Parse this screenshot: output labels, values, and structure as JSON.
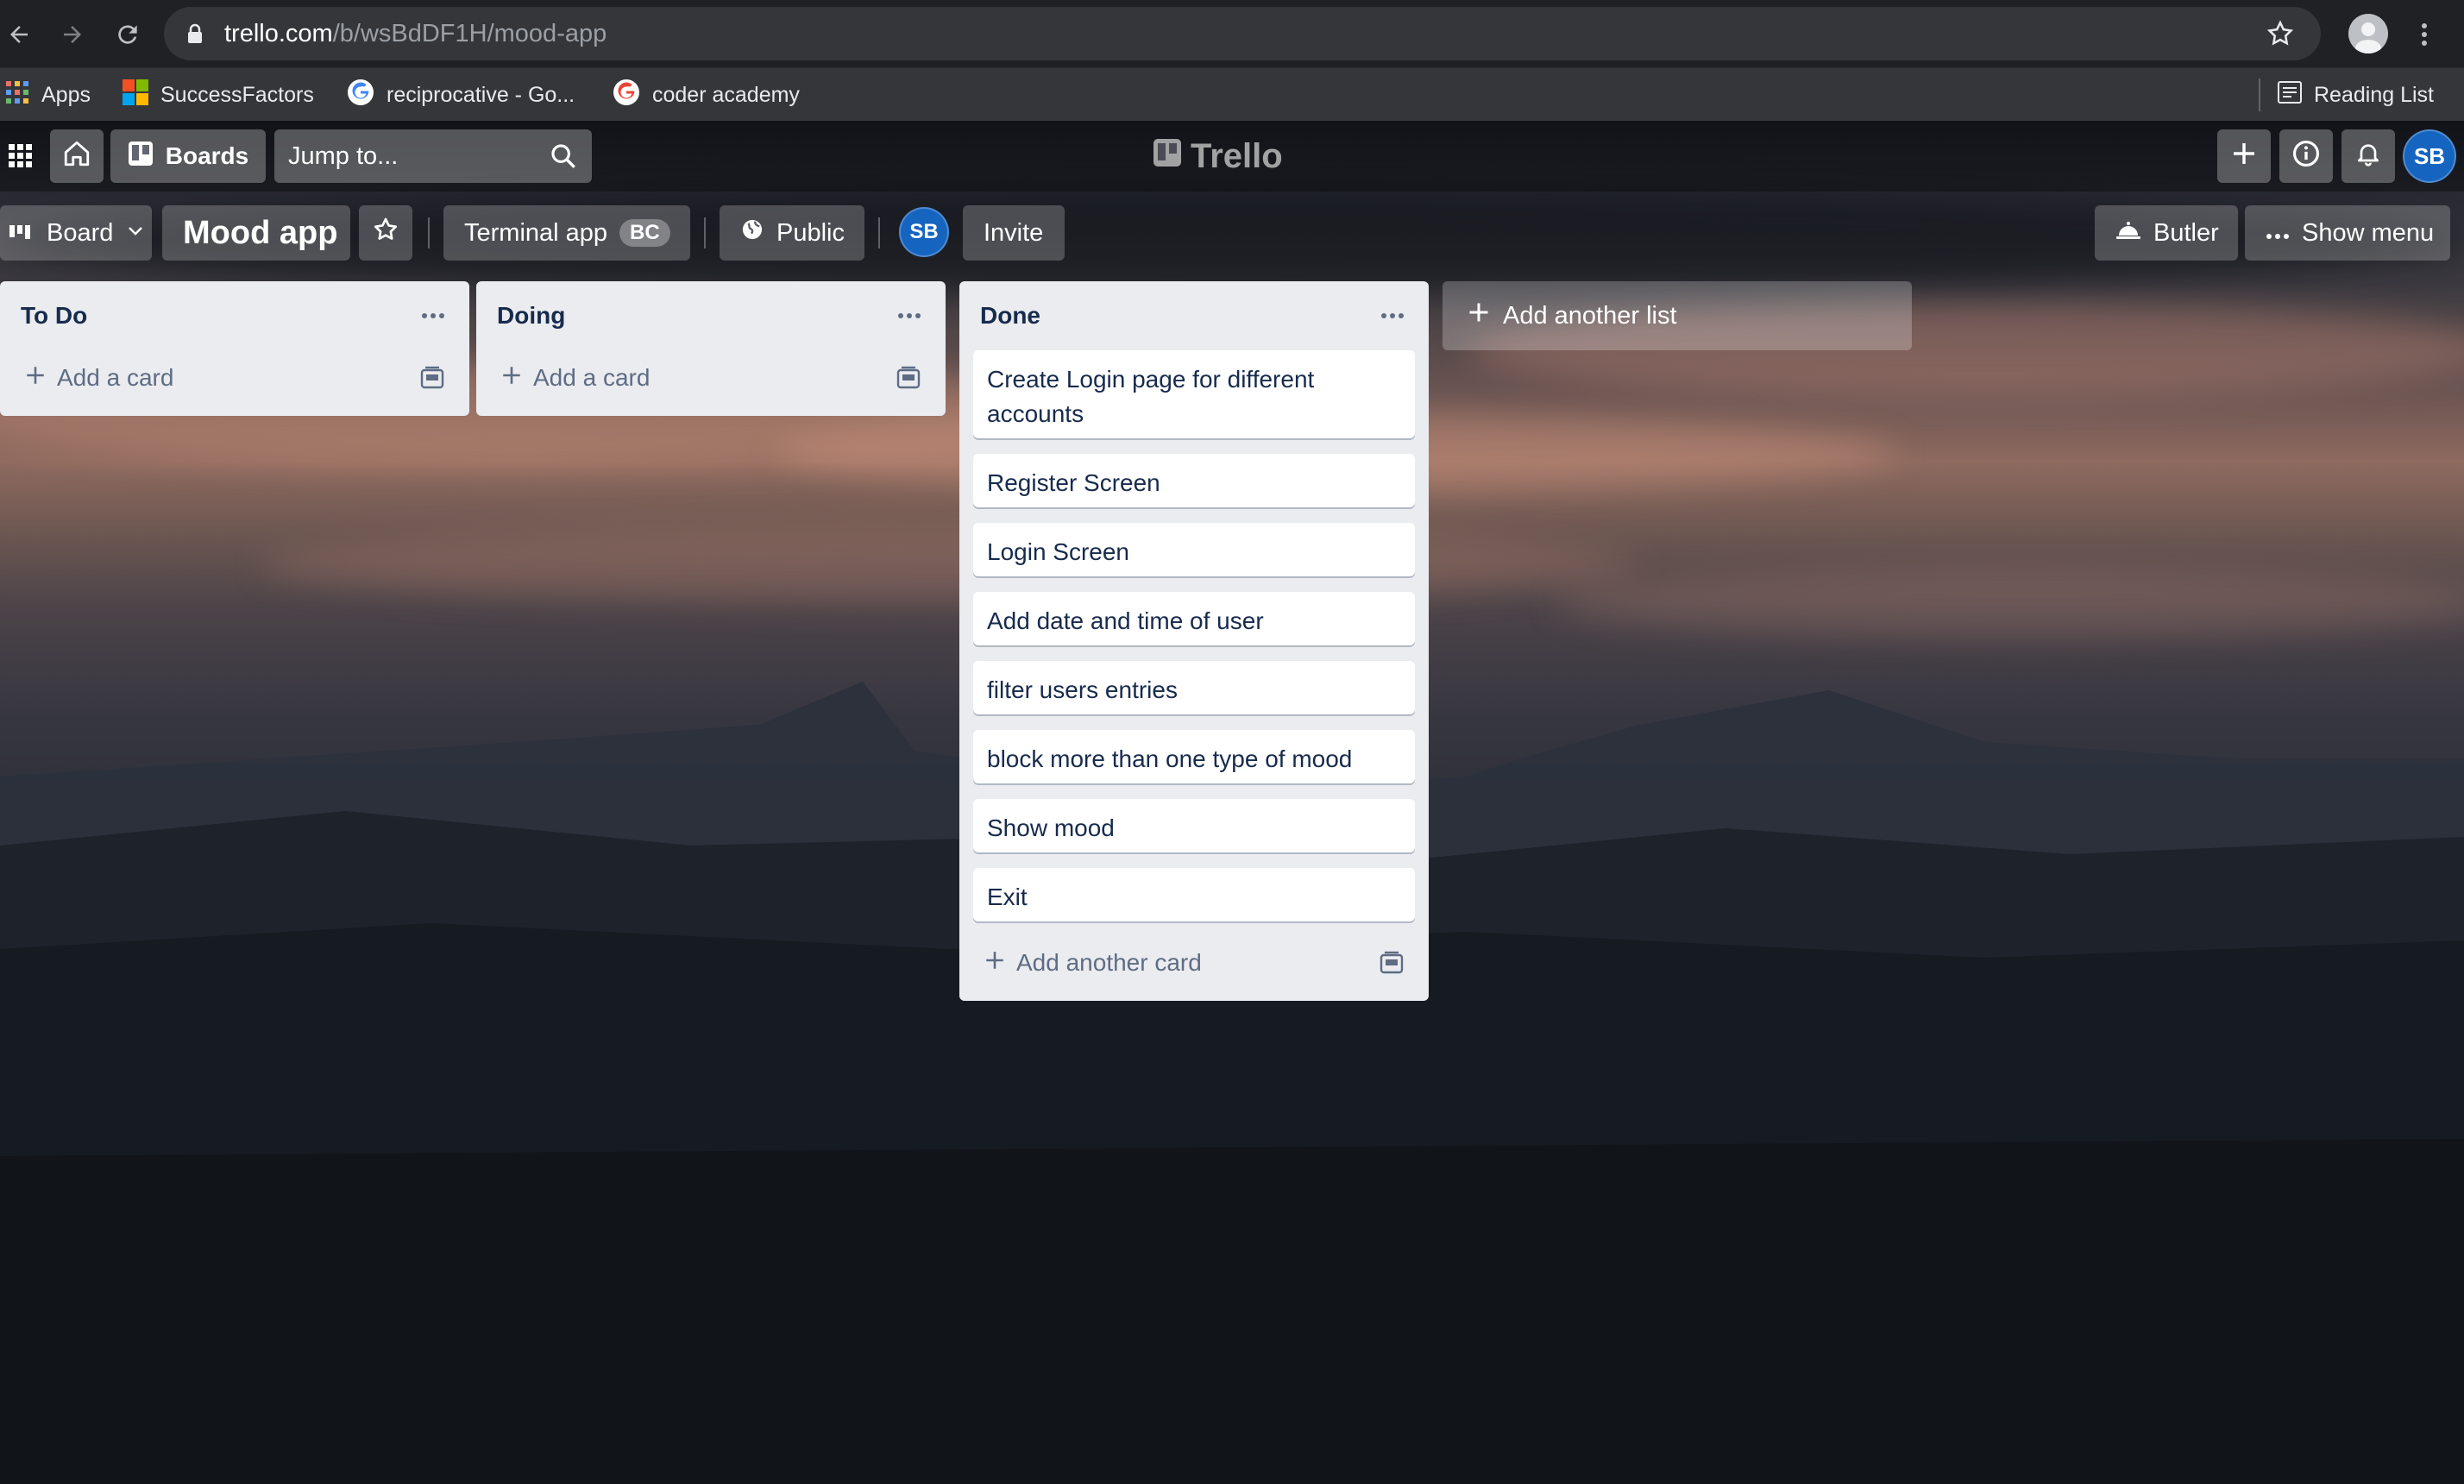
{
  "browser": {
    "url_host": "trello.com",
    "url_path": "/b/wsBdDF1H/mood-app",
    "bookmarks": [
      {
        "label": "Apps",
        "icon": "apps-grid-icon"
      },
      {
        "label": "SuccessFactors",
        "icon": "microsoft-logo-icon"
      },
      {
        "label": "reciprocative - Go...",
        "icon": "google-logo-icon"
      },
      {
        "label": "coder academy",
        "icon": "google-logo-icon"
      }
    ],
    "reading_list": "Reading List"
  },
  "header": {
    "boards_label": "Boards",
    "search_placeholder": "Jump to...",
    "logo_text": "Trello",
    "user_initials": "SB"
  },
  "toolbar": {
    "view_label": "Board",
    "board_title": "Mood app",
    "workspace_label": "Terminal app",
    "workspace_badge": "BC",
    "visibility_label": "Public",
    "member_initials": "SB",
    "invite_label": "Invite",
    "butler_label": "Butler",
    "show_menu_label": "Show menu"
  },
  "lists": [
    {
      "title": "To Do",
      "cards": [],
      "add_label": "Add a card"
    },
    {
      "title": "Doing",
      "cards": [],
      "add_label": "Add a card"
    },
    {
      "title": "Done",
      "cards": [
        "Create Login page for different accounts",
        "Register Screen",
        "Login Screen",
        "Add date and time of user",
        "filter users entries",
        "block more than one type of mood",
        "Show mood",
        "Exit"
      ],
      "add_label": "Add another card"
    }
  ],
  "add_list_label": "Add another list",
  "colors": {
    "brand_blue": "#1565c0",
    "list_bg": "#ebecf0",
    "card_text": "#172b4d"
  }
}
